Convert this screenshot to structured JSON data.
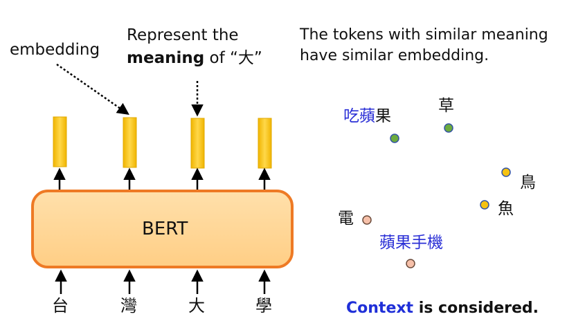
{
  "left": {
    "embedding_label": "embedding",
    "represent": {
      "line1": "Represent the",
      "bold": "meaning",
      "rest": " of “大”"
    },
    "model_label": "BERT",
    "input_tokens": [
      "台",
      "灣",
      "大",
      "學"
    ]
  },
  "right": {
    "note_line1": "The tokens with similar meaning",
    "note_line2": "have similar embedding.",
    "words": {
      "apple_blue": "吃蘋",
      "apple_black": "果",
      "grass": "草",
      "bird": "鳥",
      "fish": "魚",
      "electric": "電",
      "iphone": "蘋果手機"
    },
    "context_highlight": "Context",
    "context_rest": " is considered."
  },
  "colors": {
    "bar_gold": "#f4c21a",
    "box_fill": "#ffd697",
    "box_border": "#ee7a25",
    "dot_green": "#6cab3e",
    "dot_gold": "#f5c211",
    "dot_pink": "#f6c0a9",
    "dot_stroke": "#3353a3",
    "blue_text": "#2a2fd6"
  }
}
